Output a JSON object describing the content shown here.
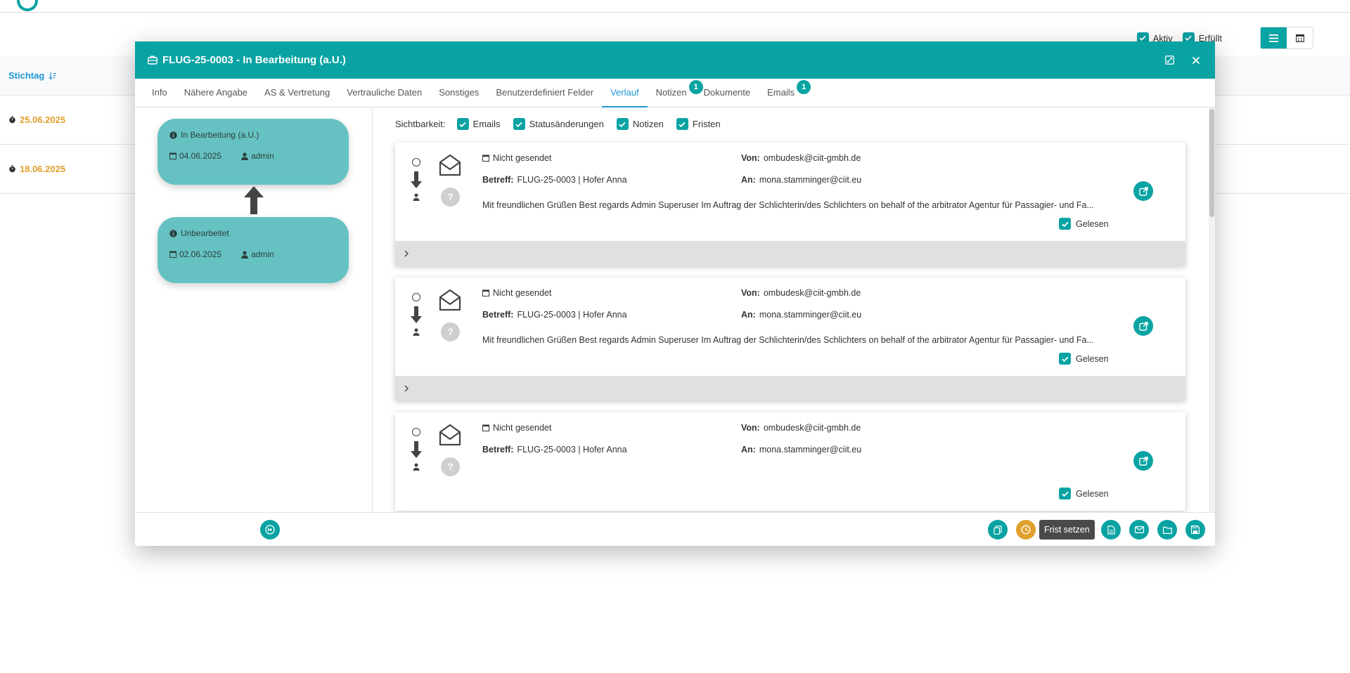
{
  "background": {
    "filters": [
      {
        "label": "Aktiv",
        "checked": true
      },
      {
        "label": "Erfüllt",
        "checked": true
      }
    ],
    "table": {
      "column_header": "Stichtag",
      "rows": [
        {
          "date": "25.06.2025"
        },
        {
          "date": "18.06.2025"
        }
      ]
    }
  },
  "modal": {
    "title": "FLUG-25-0003 - In Bearbeitung (a.U.)",
    "tabs": [
      {
        "label": "Info"
      },
      {
        "label": "Nähere Angabe"
      },
      {
        "label": "AS & Vertretung"
      },
      {
        "label": "Vertrauliche Daten"
      },
      {
        "label": "Sonstiges"
      },
      {
        "label": "Benutzerdefiniert Felder"
      },
      {
        "label": "Verlauf",
        "active": true
      },
      {
        "label": "Notizen",
        "badge": "1"
      },
      {
        "label": "Dokumente"
      },
      {
        "label": "Emails",
        "badge": "1"
      }
    ],
    "status_history": [
      {
        "status": "In Bearbeitung (a.U.)",
        "date": "04.06.2025",
        "user": "admin"
      },
      {
        "status": "Unbearbeitet",
        "date": "02.06.2025",
        "user": "admin"
      }
    ],
    "visibility": {
      "label": "Sichtbarkeit:",
      "options": [
        {
          "label": "Emails",
          "checked": true
        },
        {
          "label": "Statusänderungen",
          "checked": true
        },
        {
          "label": "Notizen",
          "checked": true
        },
        {
          "label": "Fristen",
          "checked": true
        }
      ]
    },
    "emails": [
      {
        "status": "Nicht gesendet",
        "from_label": "Von:",
        "from": "ombudesk@ciit-gmbh.de",
        "subject_label": "Betreff:",
        "subject": "FLUG-25-0003 | Hofer Anna",
        "to_label": "An:",
        "to": "mona.stamminger@ciit.eu",
        "preview": "Mit freundlichen Grüßen Best regards Admin Superuser Im Auftrag der Schlichterin/des Schlichters on behalf of the arbitrator Agentur für Passagier- und Fa...",
        "read_label": "Gelesen",
        "read": true
      },
      {
        "status": "Nicht gesendet",
        "from_label": "Von:",
        "from": "ombudesk@ciit-gmbh.de",
        "subject_label": "Betreff:",
        "subject": "FLUG-25-0003 | Hofer Anna",
        "to_label": "An:",
        "to": "mona.stamminger@ciit.eu",
        "preview": "Mit freundlichen Grüßen Best regards Admin Superuser Im Auftrag der Schlichterin/des Schlichters on behalf of the arbitrator Agentur für Passagier- und Fa...",
        "read_label": "Gelesen",
        "read": true
      },
      {
        "status": "Nicht gesendet",
        "from_label": "Von:",
        "from": "ombudesk@ciit-gmbh.de",
        "subject_label": "Betreff:",
        "subject": "FLUG-25-0003 | Hofer Anna",
        "to_label": "An:",
        "to": "mona.stamminger@ciit.eu",
        "preview": "",
        "read_label": "Gelesen",
        "read": true
      }
    ],
    "footer": {
      "tooltip": "Frist setzen"
    }
  },
  "colors": {
    "primary": "#0aa3a3",
    "card": "#66c2c2",
    "accent_blue": "#2196d3",
    "warning": "#e0a02c",
    "tooltip": "#4a4a4a"
  }
}
